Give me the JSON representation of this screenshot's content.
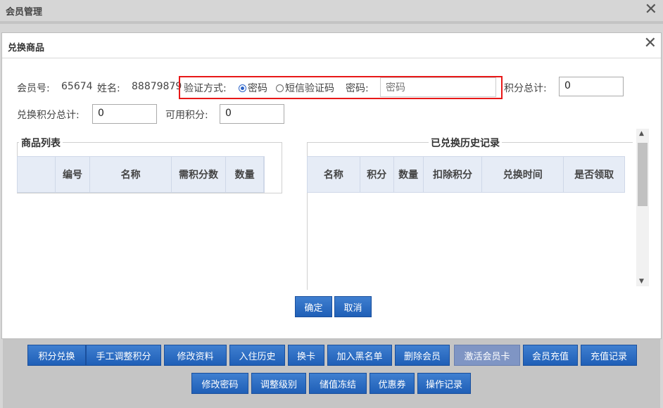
{
  "background": {
    "title": "会员管理",
    "buttons_row1": [
      "积分兑换",
      "手工调整积分",
      "修改资料",
      "入住历史",
      "换卡",
      "加入黑名单",
      "删除会员",
      "激活会员卡",
      "会员充值",
      "充值记录"
    ],
    "buttons_row2": [
      "修改密码",
      "调整级别",
      "储值冻结",
      "优惠券",
      "操作记录"
    ]
  },
  "modal": {
    "title": "兑换商品",
    "member_no_label": "会员号:",
    "member_no": "65674",
    "name_label": "姓名:",
    "name": "88879879",
    "verify_label": "验证方式:",
    "verify_options": [
      "密码",
      "短信验证码"
    ],
    "verify_selected": "密码",
    "password_label": "密码:",
    "password_placeholder": "密码",
    "points_total_label": "积分总计:",
    "points_total": "0",
    "exchange_total_label": "兑换积分总计:",
    "exchange_total": "0",
    "available_label": "可用积分:",
    "available": "0",
    "goods_list": {
      "legend": "商品列表",
      "columns": [
        "",
        "编号",
        "名称",
        "需积分数",
        "数量"
      ]
    },
    "history": {
      "legend": "已兑换历史记录",
      "columns": [
        "名称",
        "积分",
        "数量",
        "扣除积分",
        "兑换时间",
        "是否领取"
      ]
    },
    "confirm": "确定",
    "cancel": "取消"
  },
  "colors": {
    "accent": "#2a6ac8",
    "highlight_border": "#e81818"
  }
}
